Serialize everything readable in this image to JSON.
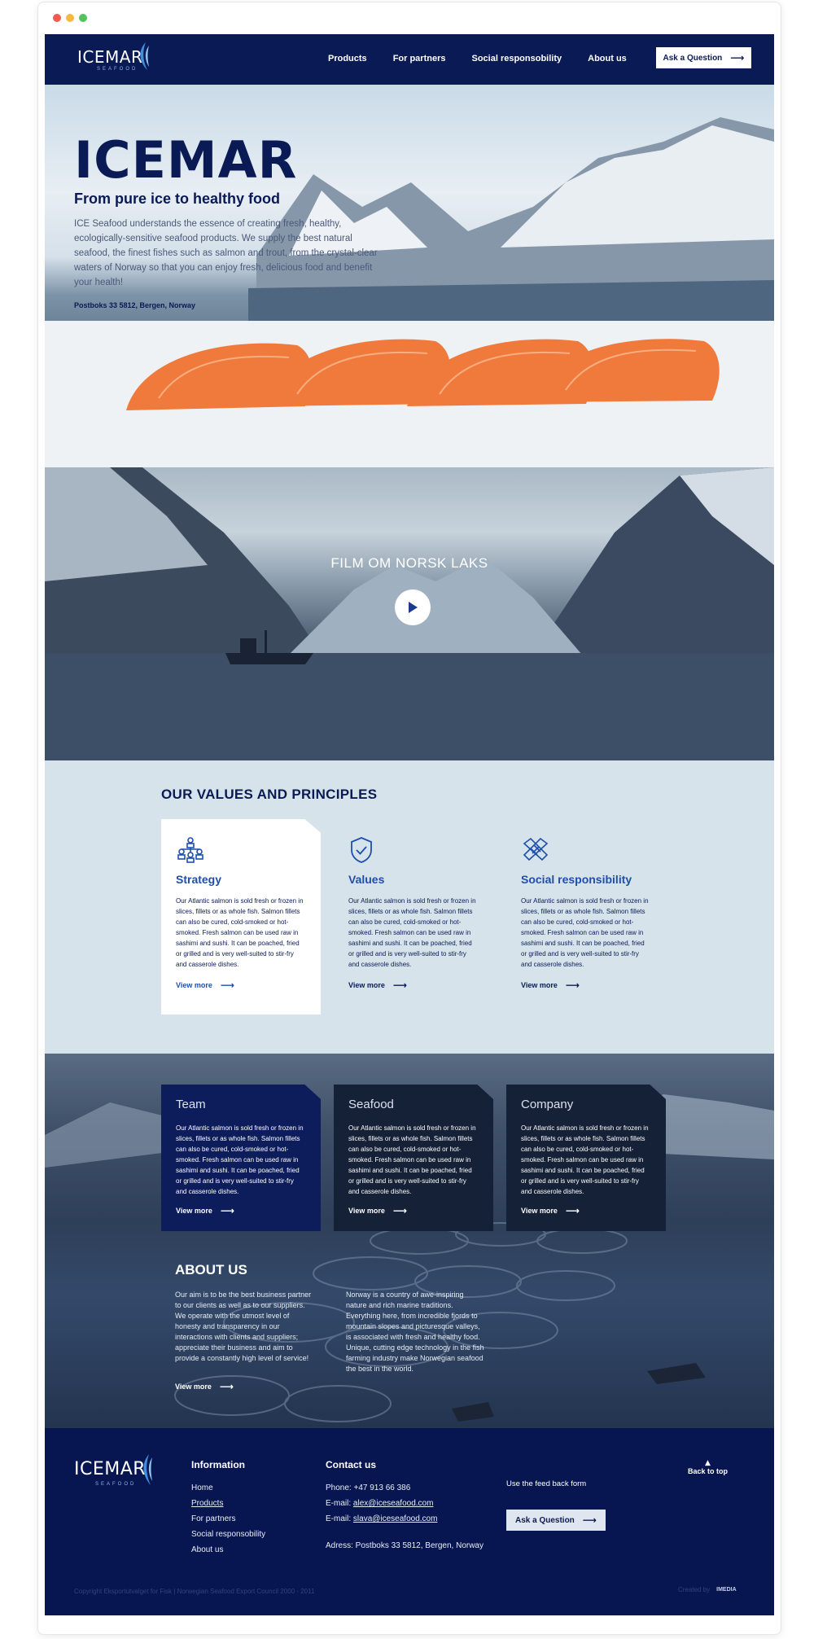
{
  "window": {
    "dot_colors": [
      "#f05a4f",
      "#f5b93e",
      "#56c25a"
    ]
  },
  "header": {
    "logo_text": "ICEMAR",
    "logo_subtext": "SEAFOOD",
    "nav": [
      {
        "label": "Products",
        "active": true
      },
      {
        "label": "For partners",
        "active": false
      },
      {
        "label": "Social responsobility",
        "active": false
      },
      {
        "label": "About us",
        "active": false
      }
    ],
    "cta_label": "Ask a Question"
  },
  "hero": {
    "title": "ICEMAR",
    "subtitle": "From pure ice to healthy food",
    "text": "ICE Seafood understands the essence of creating fresh, healthy, ecologically-sensitive seafood products. We supply the best natural seafood, the finest fishes such as salmon and trout, from the crystal-clear waters of Norway so that you can enjoy fresh, delicious food and benefit your health!",
    "address": "Postboks 33 5812, Bergen, Norway"
  },
  "video": {
    "title": "FILM OM NORSK LAKS"
  },
  "values": {
    "title": "OUR VALUES AND PRINCIPLES",
    "cards": [
      {
        "title": "Strategy",
        "icon": "strategy-icon",
        "text": "Our Atlantic salmon is sold fresh or frozen in slices, fillets or as whole fish. Salmon fillets can also be cured, cold-smoked or hot-smoked. Fresh salmon can be used raw in sashimi and sushi. It can be poached, fried or grilled and is very well-suited to stir-fry and casserole dishes.",
        "more": "View more"
      },
      {
        "title": "Values",
        "icon": "shield-icon",
        "text": "Our Atlantic salmon is sold fresh or frozen in slices, fillets or as whole fish. Salmon fillets can also be cured, cold-smoked or hot-smoked. Fresh salmon can be used raw in sashimi and sushi. It can be poached, fried or grilled and is very well-suited to stir-fry and casserole dishes.",
        "more": "View more"
      },
      {
        "title": "Social responsibility",
        "icon": "handshake-icon",
        "text": "Our Atlantic salmon is sold fresh or frozen in slices, fillets or as whole fish. Salmon fillets can also be cured, cold-smoked or hot-smoked. Fresh salmon can be used raw in sashimi and sushi. It can be poached, fried or grilled and is very well-suited to stir-fry and casserole dishes.",
        "more": "View more"
      }
    ]
  },
  "about": {
    "cards": [
      {
        "title": "Team",
        "text": "Our Atlantic salmon is sold fresh or frozen in slices, fillets or as whole fish. Salmon fillets can also be cured, cold-smoked or hot-smoked. Fresh salmon can be used raw in sashimi and sushi. It can be poached, fried or grilled and is very well-suited to stir-fry and casserole dishes.",
        "more": "View more"
      },
      {
        "title": "Seafood",
        "text": "Our Atlantic salmon is sold fresh or frozen in slices, fillets or as whole fish. Salmon fillets can also be cured, cold-smoked or hot-smoked. Fresh salmon can be used raw in sashimi and sushi. It can be poached, fried or grilled and is very well-suited to stir-fry and casserole dishes.",
        "more": "View more"
      },
      {
        "title": "Company",
        "text": "Our Atlantic salmon is sold fresh or frozen in slices, fillets or as whole fish. Salmon fillets can also be cured, cold-smoked or hot-smoked. Fresh salmon can be used raw in sashimi and sushi. It can be poached, fried or grilled and is very well-suited to stir-fry and casserole dishes.",
        "more": "View more"
      }
    ],
    "title": "ABOUT US",
    "text_left": "Our aim is to be the best business partner to our clients as well as to our suppliers. We operate with the utmost level of honesty and transparency in our interactions with clients and suppliers; appreciate their business and aim to provide a constantly high level of service!",
    "text_right": "Norway is a country of awe-inspiring nature and rich marine traditions. Everything here, from incredible fjords to mountain slopes and picturesque valleys, is associated with fresh and healthy food. Unique, cutting edge technology in the fish farming industry make Norwegian seafood the best in the world.",
    "more": "View more"
  },
  "footer": {
    "logo_text": "ICEMAR",
    "logo_subtext": "SEAFOOD",
    "info_title": "Information",
    "links": [
      {
        "label": "Home",
        "active": false
      },
      {
        "label": "Products",
        "active": true
      },
      {
        "label": "For partners",
        "active": false
      },
      {
        "label": "Social responsobility",
        "active": false
      },
      {
        "label": "About us",
        "active": false
      }
    ],
    "contact_title": "Contact us",
    "phone_label": "Phone:",
    "phone": "+47 913 66 386",
    "email_label": "E-mail:",
    "email1": "alex@iceseafood.com",
    "email2": "slava@iceseafood.com",
    "address": "Adress: Postboks 33 5812, Bergen, Norway",
    "feedback_label": "Use the feed back form",
    "cta_label": "Ask a Question",
    "back_to_top": "Back to top",
    "copyright": "Copyright Eksportutvalget for Fisk | Norwegian Seafood Export Council 2000 - 2011",
    "created_by": "Created by",
    "created_brand": "IMEDIA"
  }
}
